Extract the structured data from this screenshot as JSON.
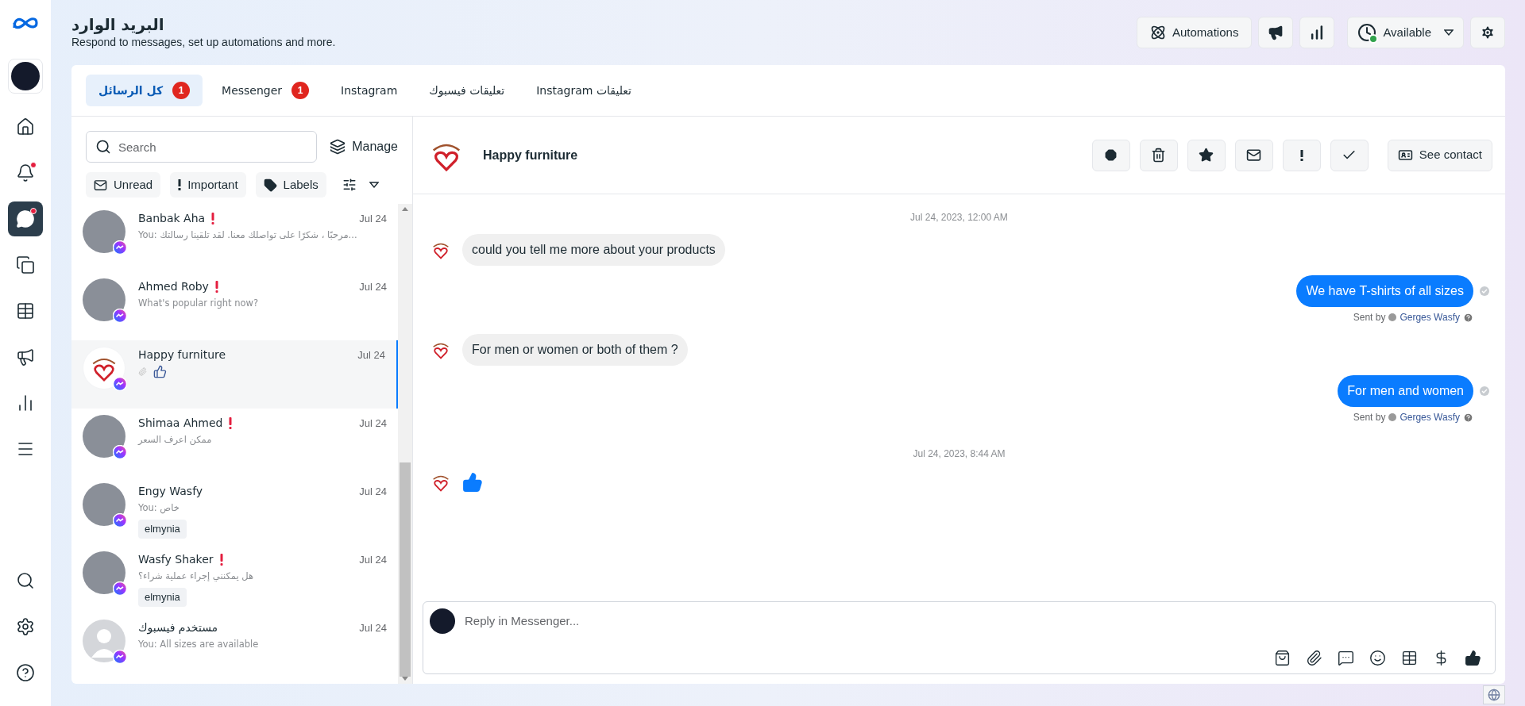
{
  "sidebar": {
    "items": [
      {
        "kind": "home",
        "selected": false,
        "notification": false
      },
      {
        "kind": "bell",
        "selected": false,
        "notification": true
      },
      {
        "kind": "chat",
        "selected": true,
        "notification": true
      },
      {
        "kind": "pages",
        "selected": false,
        "notification": false
      },
      {
        "kind": "table",
        "selected": false,
        "notification": false
      },
      {
        "kind": "megaphone",
        "selected": false,
        "notification": false
      },
      {
        "kind": "chart",
        "selected": false,
        "notification": false
      },
      {
        "kind": "menu",
        "selected": false,
        "notification": false
      }
    ],
    "bottom_items": [
      {
        "kind": "search"
      },
      {
        "kind": "settings"
      },
      {
        "kind": "help"
      }
    ]
  },
  "header": {
    "title": "البريد الوارد",
    "subtitle": "Respond to messages, set up automations and more.",
    "automations": "Automations",
    "status": {
      "label": "Available",
      "online": true
    }
  },
  "tabs": [
    {
      "label": "كل الرسائل",
      "badge": "1",
      "selected": true
    },
    {
      "label": "Messenger",
      "badge": "1",
      "selected": false
    },
    {
      "label": "Instagram",
      "selected": false
    },
    {
      "label": "تعليقات فيسبوك",
      "selected": false
    },
    {
      "label": "Instagram تعليقات",
      "selected": false
    }
  ],
  "inbox": {
    "search": {
      "placeholder": "Search"
    },
    "manage": "Manage",
    "filters": [
      {
        "kind": "unread",
        "label": "Unread"
      },
      {
        "kind": "important",
        "label": "Important"
      },
      {
        "kind": "labels",
        "label": "Labels"
      }
    ],
    "conversations": [
      {
        "name": "Banbak Aha",
        "preview": "You: مرحبًا ، شكرًا على تواصلك معنا. لقد تلقينا رسالتك...",
        "date": "Jul 24",
        "important": true,
        "selected": false,
        "avatar": {
          "kind": "photo"
        }
      },
      {
        "name": "Ahmed Roby",
        "preview": "What's popular right now?",
        "date": "Jul 24",
        "important": true,
        "selected": false,
        "avatar": {
          "kind": "photo"
        }
      },
      {
        "name": "Happy furniture",
        "attachment": {
          "kind": "like"
        },
        "date": "Jul 24",
        "important": false,
        "selected": true,
        "avatar": {
          "kind": "logo"
        }
      },
      {
        "name": "Shimaa Ahmed",
        "preview": "ممكن اعرف السعر",
        "date": "Jul 24",
        "important": true,
        "selected": false,
        "avatar": {
          "kind": "photo"
        }
      },
      {
        "name": "Engy Wasfy",
        "preview": "You: خاص",
        "date": "Jul 24",
        "important": false,
        "selected": false,
        "avatar": {
          "kind": "photo"
        },
        "labels": [
          "elmynia"
        ]
      },
      {
        "name": "Wasfy Shaker",
        "preview": "هل يمكنني إجراء عملية شراء؟",
        "date": "Jul 24",
        "important": true,
        "selected": false,
        "avatar": {
          "kind": "photo"
        },
        "labels": [
          "elmynia"
        ]
      },
      {
        "name": "مستخدم فيسبوك",
        "preview": "You: All sizes are available",
        "date": "Jul 24",
        "important": false,
        "selected": false,
        "avatar": {
          "kind": "default"
        }
      }
    ]
  },
  "chat": {
    "contact": "Happy furniture",
    "actions": [
      {
        "kind": "spam"
      },
      {
        "kind": "delete"
      },
      {
        "kind": "star"
      },
      {
        "kind": "unread"
      },
      {
        "kind": "important"
      },
      {
        "kind": "done"
      }
    ],
    "see_contact": "See contact",
    "messages": [
      {
        "kind": "timestamp",
        "text": "Jul 24, 2023, 12:00 AM"
      },
      {
        "kind": "incoming",
        "text": "could you tell me more about your products"
      },
      {
        "kind": "outgoing",
        "text": "We have T-shirts of all sizes",
        "sent_by": "Sent by",
        "sender": "Gerges Wasfy"
      },
      {
        "kind": "incoming",
        "text": "For men or women or both of them ?"
      },
      {
        "kind": "outgoing",
        "text": "For men and women",
        "sent_by": "Sent by",
        "sender": "Gerges Wasfy"
      },
      {
        "kind": "timestamp",
        "text": "Jul 24, 2023, 8:44 AM"
      },
      {
        "kind": "like"
      }
    ],
    "composer": {
      "placeholder": "Reply in Messenger...",
      "tools": [
        {
          "kind": "shop"
        },
        {
          "kind": "attach"
        },
        {
          "kind": "saved-reply"
        },
        {
          "kind": "emoji"
        },
        {
          "kind": "table"
        },
        {
          "kind": "payment"
        },
        {
          "kind": "like"
        }
      ]
    }
  }
}
